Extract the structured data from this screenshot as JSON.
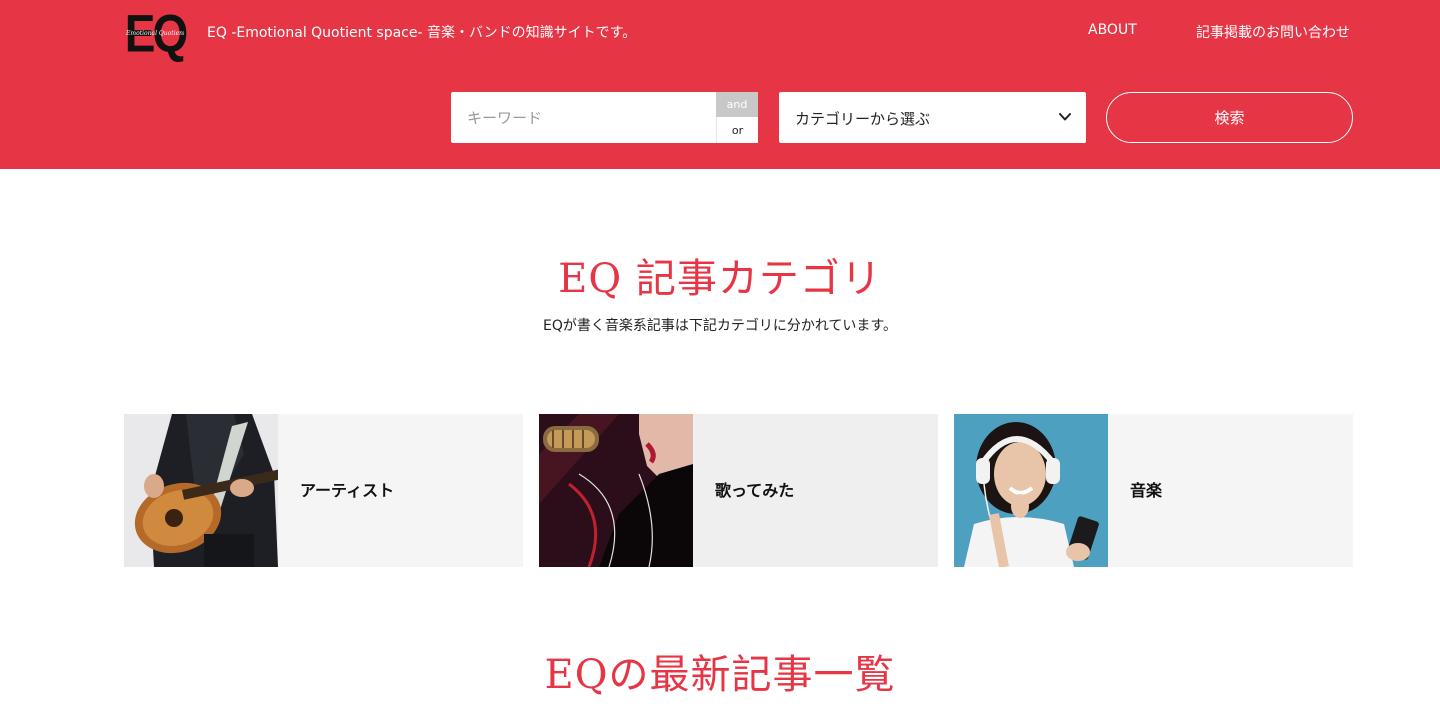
{
  "header": {
    "logo_text": "EQ",
    "logo_script": "Emotional Quotient space",
    "tagline": "EQ -Emotional Quotient space- 音楽・バンドの知識サイトです。",
    "nav": {
      "about": "ABOUT",
      "contact": "記事掲載のお問い合わせ"
    },
    "search": {
      "placeholder": "キーワード",
      "and_label": "and",
      "or_label": "or",
      "category_select": "カテゴリーから選ぶ",
      "search_button": "検索"
    },
    "colors": {
      "brand": "#e63545"
    }
  },
  "categories_section": {
    "title": "EQ 記事カテゴリ",
    "description": "EQが書く音楽系記事は下記カテゴリに分かれています。",
    "cards": [
      {
        "label": "アーティスト",
        "icon": "guitarist-photo"
      },
      {
        "label": "歌ってみた",
        "icon": "singer-microphone-photo"
      },
      {
        "label": "音楽",
        "icon": "headphones-woman-photo"
      }
    ]
  },
  "latest_section": {
    "title": "EQの最新記事一覧"
  }
}
